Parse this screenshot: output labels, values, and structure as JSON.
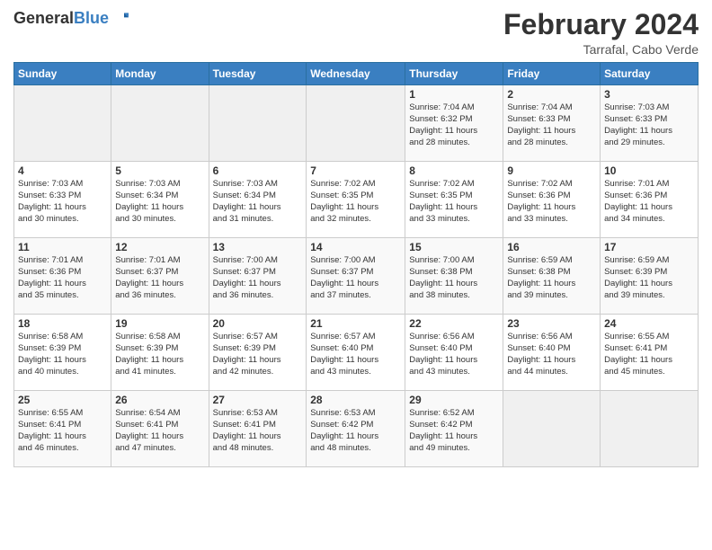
{
  "header": {
    "logo_general": "General",
    "logo_blue": "Blue",
    "title": "February 2024",
    "subtitle": "Tarrafal, Cabo Verde"
  },
  "weekdays": [
    "Sunday",
    "Monday",
    "Tuesday",
    "Wednesday",
    "Thursday",
    "Friday",
    "Saturday"
  ],
  "weeks": [
    [
      {
        "day": "",
        "info": ""
      },
      {
        "day": "",
        "info": ""
      },
      {
        "day": "",
        "info": ""
      },
      {
        "day": "",
        "info": ""
      },
      {
        "day": "1",
        "info": "Sunrise: 7:04 AM\nSunset: 6:32 PM\nDaylight: 11 hours\nand 28 minutes."
      },
      {
        "day": "2",
        "info": "Sunrise: 7:04 AM\nSunset: 6:33 PM\nDaylight: 11 hours\nand 28 minutes."
      },
      {
        "day": "3",
        "info": "Sunrise: 7:03 AM\nSunset: 6:33 PM\nDaylight: 11 hours\nand 29 minutes."
      }
    ],
    [
      {
        "day": "4",
        "info": "Sunrise: 7:03 AM\nSunset: 6:33 PM\nDaylight: 11 hours\nand 30 minutes."
      },
      {
        "day": "5",
        "info": "Sunrise: 7:03 AM\nSunset: 6:34 PM\nDaylight: 11 hours\nand 30 minutes."
      },
      {
        "day": "6",
        "info": "Sunrise: 7:03 AM\nSunset: 6:34 PM\nDaylight: 11 hours\nand 31 minutes."
      },
      {
        "day": "7",
        "info": "Sunrise: 7:02 AM\nSunset: 6:35 PM\nDaylight: 11 hours\nand 32 minutes."
      },
      {
        "day": "8",
        "info": "Sunrise: 7:02 AM\nSunset: 6:35 PM\nDaylight: 11 hours\nand 33 minutes."
      },
      {
        "day": "9",
        "info": "Sunrise: 7:02 AM\nSunset: 6:36 PM\nDaylight: 11 hours\nand 33 minutes."
      },
      {
        "day": "10",
        "info": "Sunrise: 7:01 AM\nSunset: 6:36 PM\nDaylight: 11 hours\nand 34 minutes."
      }
    ],
    [
      {
        "day": "11",
        "info": "Sunrise: 7:01 AM\nSunset: 6:36 PM\nDaylight: 11 hours\nand 35 minutes."
      },
      {
        "day": "12",
        "info": "Sunrise: 7:01 AM\nSunset: 6:37 PM\nDaylight: 11 hours\nand 36 minutes."
      },
      {
        "day": "13",
        "info": "Sunrise: 7:00 AM\nSunset: 6:37 PM\nDaylight: 11 hours\nand 36 minutes."
      },
      {
        "day": "14",
        "info": "Sunrise: 7:00 AM\nSunset: 6:37 PM\nDaylight: 11 hours\nand 37 minutes."
      },
      {
        "day": "15",
        "info": "Sunrise: 7:00 AM\nSunset: 6:38 PM\nDaylight: 11 hours\nand 38 minutes."
      },
      {
        "day": "16",
        "info": "Sunrise: 6:59 AM\nSunset: 6:38 PM\nDaylight: 11 hours\nand 39 minutes."
      },
      {
        "day": "17",
        "info": "Sunrise: 6:59 AM\nSunset: 6:39 PM\nDaylight: 11 hours\nand 39 minutes."
      }
    ],
    [
      {
        "day": "18",
        "info": "Sunrise: 6:58 AM\nSunset: 6:39 PM\nDaylight: 11 hours\nand 40 minutes."
      },
      {
        "day": "19",
        "info": "Sunrise: 6:58 AM\nSunset: 6:39 PM\nDaylight: 11 hours\nand 41 minutes."
      },
      {
        "day": "20",
        "info": "Sunrise: 6:57 AM\nSunset: 6:39 PM\nDaylight: 11 hours\nand 42 minutes."
      },
      {
        "day": "21",
        "info": "Sunrise: 6:57 AM\nSunset: 6:40 PM\nDaylight: 11 hours\nand 43 minutes."
      },
      {
        "day": "22",
        "info": "Sunrise: 6:56 AM\nSunset: 6:40 PM\nDaylight: 11 hours\nand 43 minutes."
      },
      {
        "day": "23",
        "info": "Sunrise: 6:56 AM\nSunset: 6:40 PM\nDaylight: 11 hours\nand 44 minutes."
      },
      {
        "day": "24",
        "info": "Sunrise: 6:55 AM\nSunset: 6:41 PM\nDaylight: 11 hours\nand 45 minutes."
      }
    ],
    [
      {
        "day": "25",
        "info": "Sunrise: 6:55 AM\nSunset: 6:41 PM\nDaylight: 11 hours\nand 46 minutes."
      },
      {
        "day": "26",
        "info": "Sunrise: 6:54 AM\nSunset: 6:41 PM\nDaylight: 11 hours\nand 47 minutes."
      },
      {
        "day": "27",
        "info": "Sunrise: 6:53 AM\nSunset: 6:41 PM\nDaylight: 11 hours\nand 48 minutes."
      },
      {
        "day": "28",
        "info": "Sunrise: 6:53 AM\nSunset: 6:42 PM\nDaylight: 11 hours\nand 48 minutes."
      },
      {
        "day": "29",
        "info": "Sunrise: 6:52 AM\nSunset: 6:42 PM\nDaylight: 11 hours\nand 49 minutes."
      },
      {
        "day": "",
        "info": ""
      },
      {
        "day": "",
        "info": ""
      }
    ]
  ]
}
